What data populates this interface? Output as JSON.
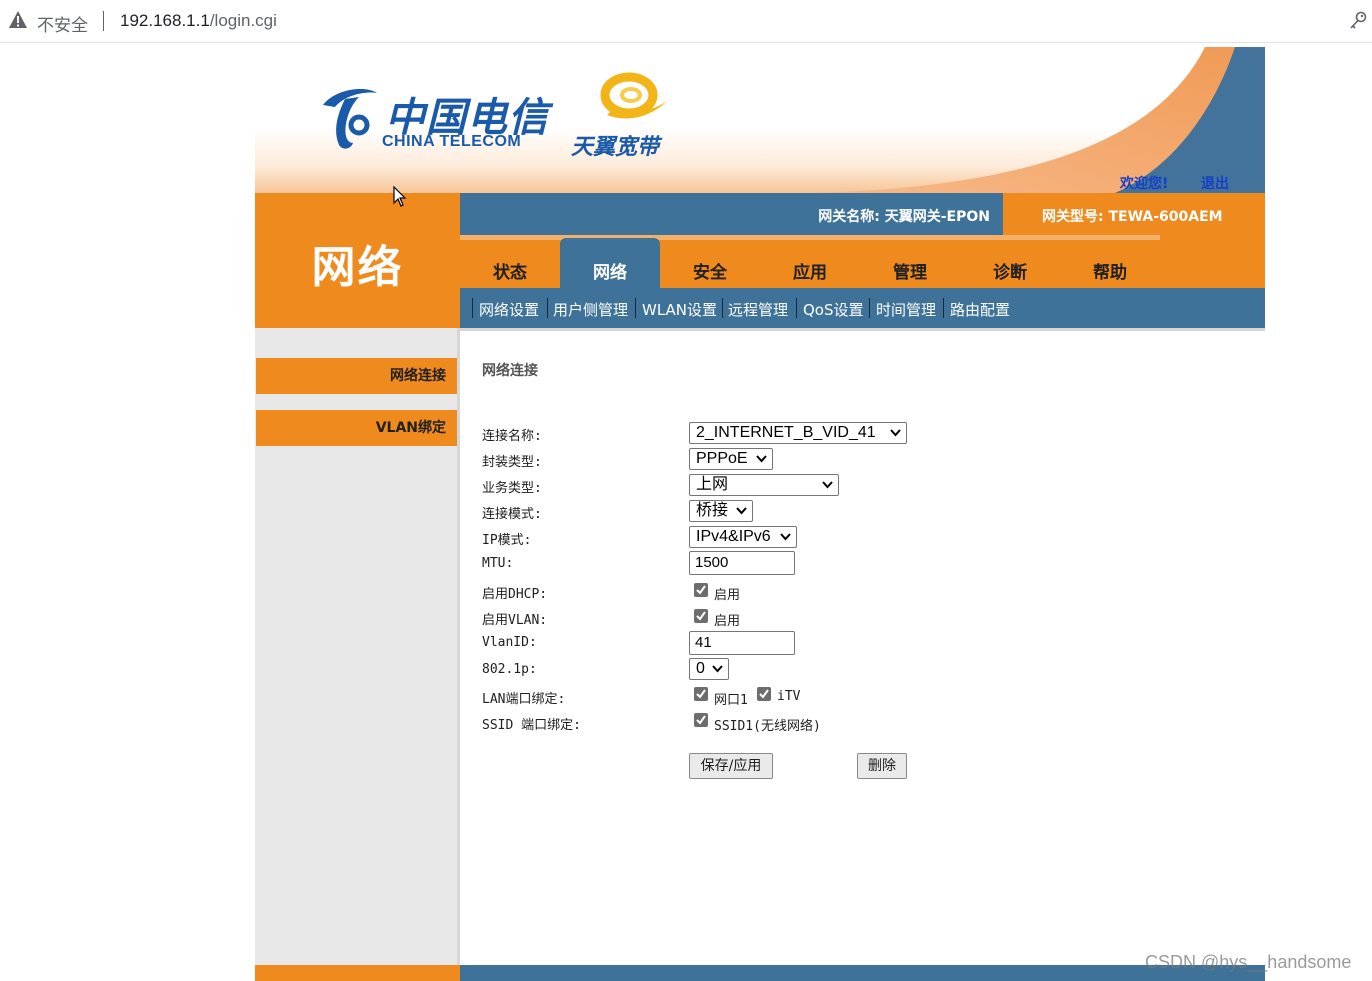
{
  "browser": {
    "security_label": "不安全",
    "url_host": "192.168.1.1",
    "url_path": "/login.cgi"
  },
  "header": {
    "logo_cn": "中国电信",
    "logo_en": "CHINA TELECOM",
    "brand_tianyi": "天翼宽带",
    "welcome": "欢迎您!",
    "logout": "退出"
  },
  "section": {
    "title": "网络"
  },
  "info": {
    "gateway_name": "网关名称:  天翼网关-EPON",
    "gateway_model": "网关型号:  TEWA-600AEM"
  },
  "tabs": [
    {
      "label": "状态"
    },
    {
      "label": "网络"
    },
    {
      "label": "安全"
    },
    {
      "label": "应用"
    },
    {
      "label": "管理"
    },
    {
      "label": "诊断"
    },
    {
      "label": "帮助"
    }
  ],
  "active_tab": "网络",
  "subnav": [
    {
      "label": "网络设置"
    },
    {
      "label": "用户侧管理"
    },
    {
      "label": "WLAN设置"
    },
    {
      "label": "远程管理"
    },
    {
      "label": "QoS设置"
    },
    {
      "label": "时间管理"
    },
    {
      "label": "路由配置"
    }
  ],
  "sidebar": [
    {
      "label": "网络连接"
    },
    {
      "label": "VLAN绑定"
    }
  ],
  "content": {
    "title": "网络连接",
    "labels": {
      "conn_name": "连接名称:",
      "encap": "封装类型:",
      "service": "业务类型:",
      "conn_mode": "连接模式:",
      "ip_mode": "IP模式:",
      "mtu": "MTU:",
      "dhcp": "启用DHCP:",
      "vlan": "启用VLAN:",
      "vlanid": "VlanID:",
      "p8021": "802.1p:",
      "lan_bind": "LAN端口绑定:",
      "ssid_bind": "SSID 端口绑定:"
    },
    "values": {
      "conn_name": "2_INTERNET_B_VID_41",
      "encap": "PPPoE",
      "service": "上网",
      "conn_mode": "桥接",
      "ip_mode": "IPv4&IPv6",
      "mtu": "1500",
      "vlanid": "41",
      "p8021": "0"
    },
    "checkboxes": {
      "dhcp_label": "启用",
      "dhcp_checked": true,
      "vlan_label": "启用",
      "vlan_checked": true,
      "lan1_label": "网口1",
      "lan1_checked": true,
      "itv_label": "iTV",
      "itv_checked": true,
      "ssid1_label": "SSID1(无线网络)",
      "ssid1_checked": true
    },
    "buttons": {
      "save": "保存/应用",
      "delete": "删除"
    }
  },
  "watermark": "CSDN @hys__handsome",
  "colors": {
    "orange": "#ef8a1f",
    "blue": "#3f7298",
    "link_blue": "#1740c8"
  }
}
